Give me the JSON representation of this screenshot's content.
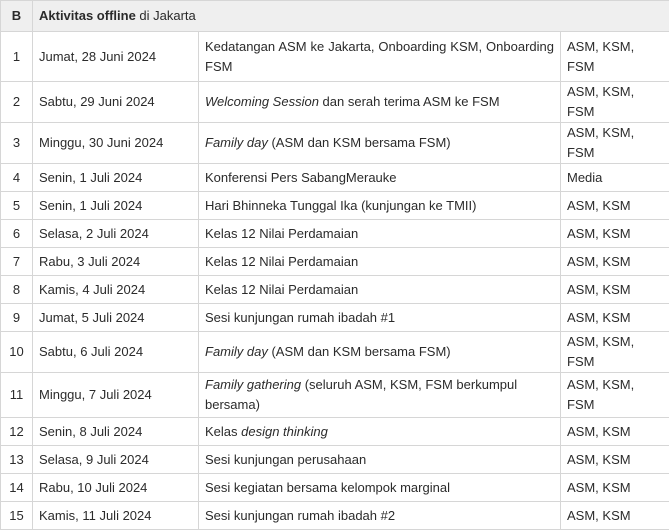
{
  "header": {
    "letter": "B",
    "title_bold": "Aktivitas offline",
    "title_rest": " di Jakarta"
  },
  "rows": [
    {
      "no": "1",
      "date": "Jumat, 28 Juni 2024",
      "desc_pre": "Kedatangan ASM ke Jakarta, Onboarding KSM, Onboarding FSM",
      "desc_em": "",
      "desc_post": "",
      "who": "ASM, KSM, FSM"
    },
    {
      "no": "2",
      "date": "Sabtu, 29 Juni 2024",
      "desc_pre": "",
      "desc_em": "Welcoming Session",
      "desc_post": " dan serah terima ASM ke FSM",
      "who": "ASM, KSM, FSM"
    },
    {
      "no": "3",
      "date": "Minggu, 30 Juni 2024",
      "desc_pre": "",
      "desc_em": "Family day",
      "desc_post": " (ASM dan KSM bersama FSM)",
      "who": "ASM, KSM, FSM"
    },
    {
      "no": "4",
      "date": "Senin, 1 Juli 2024",
      "desc_pre": "Konferensi Pers SabangMerauke",
      "desc_em": "",
      "desc_post": "",
      "who": "Media"
    },
    {
      "no": "5",
      "date": "Senin, 1 Juli 2024",
      "desc_pre": "Hari Bhinneka Tunggal Ika (kunjungan ke TMII)",
      "desc_em": "",
      "desc_post": "",
      "who": "ASM, KSM"
    },
    {
      "no": "6",
      "date": "Selasa, 2 Juli 2024",
      "desc_pre": "Kelas 12 Nilai Perdamaian",
      "desc_em": "",
      "desc_post": "",
      "who": "ASM, KSM"
    },
    {
      "no": "7",
      "date": "Rabu, 3 Juli 2024",
      "desc_pre": "Kelas 12 Nilai Perdamaian",
      "desc_em": "",
      "desc_post": "",
      "who": "ASM, KSM"
    },
    {
      "no": "8",
      "date": "Kamis, 4 Juli 2024",
      "desc_pre": "Kelas 12 Nilai Perdamaian",
      "desc_em": "",
      "desc_post": "",
      "who": "ASM, KSM"
    },
    {
      "no": "9",
      "date": "Jumat, 5 Juli 2024",
      "desc_pre": "Sesi kunjungan rumah ibadah #1",
      "desc_em": "",
      "desc_post": "",
      "who": "ASM, KSM"
    },
    {
      "no": "10",
      "date": "Sabtu, 6 Juli 2024",
      "desc_pre": "",
      "desc_em": "Family day",
      "desc_post": " (ASM dan KSM bersama FSM)",
      "who": "ASM, KSM, FSM"
    },
    {
      "no": "11",
      "date": "Minggu, 7 Juli 2024",
      "desc_pre": "",
      "desc_em": "Family gathering",
      "desc_post": " (seluruh ASM, KSM, FSM berkumpul bersama)",
      "who": "ASM, KSM, FSM"
    },
    {
      "no": "12",
      "date": "Senin, 8 Juli 2024",
      "desc_pre": "Kelas ",
      "desc_em": "design thinking",
      "desc_post": "",
      "who": "ASM, KSM"
    },
    {
      "no": "13",
      "date": "Selasa, 9 Juli 2024",
      "desc_pre": "Sesi kunjungan perusahaan",
      "desc_em": "",
      "desc_post": "",
      "who": "ASM, KSM"
    },
    {
      "no": "14",
      "date": "Rabu, 10 Juli 2024",
      "desc_pre": "Sesi kegiatan bersama kelompok marginal",
      "desc_em": "",
      "desc_post": "",
      "who": "ASM, KSM"
    },
    {
      "no": "15",
      "date": "Kamis, 11 Juli 2024",
      "desc_pre": "Sesi kunjungan rumah ibadah #2",
      "desc_em": "",
      "desc_post": "",
      "who": "ASM, KSM"
    }
  ]
}
